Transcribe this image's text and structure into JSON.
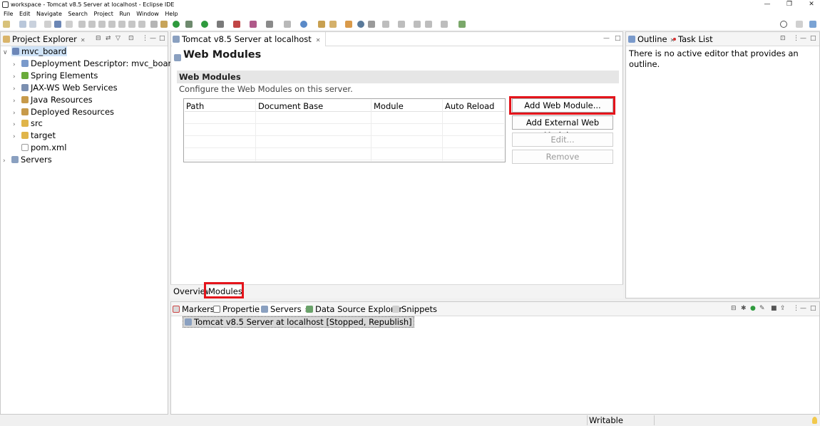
{
  "window": {
    "title": "workspace - Tomcat v8.5 Server at localhost - Eclipse IDE"
  },
  "menu": [
    "File",
    "Edit",
    "Navigate",
    "Search",
    "Project",
    "Run",
    "Window",
    "Help"
  ],
  "project_explorer": {
    "title": "Project Explorer",
    "items": [
      {
        "label": "mvc_board"
      },
      {
        "label": "Deployment Descriptor: mvc_board"
      },
      {
        "label": "Spring Elements"
      },
      {
        "label": "JAX-WS Web Services"
      },
      {
        "label": "Java Resources"
      },
      {
        "label": "Deployed Resources"
      },
      {
        "label": "src"
      },
      {
        "label": "target"
      },
      {
        "label": "pom.xml"
      },
      {
        "label": "Servers"
      }
    ]
  },
  "editor": {
    "tab_title": "Tomcat v8.5 Server at localhost",
    "page_title": "Web Modules",
    "section_title": "Web Modules",
    "section_desc": "Configure the Web Modules on this server.",
    "columns": [
      "Path",
      "Document Base",
      "Module",
      "Auto Reload"
    ],
    "buttons": {
      "add": "Add Web Module...",
      "add_external": "Add External Web Module...",
      "edit": "Edit...",
      "remove": "Remove"
    },
    "bottom_tabs": [
      "Overview",
      "Modules"
    ]
  },
  "outline": {
    "tab_outline": "Outline",
    "tab_tasks": "Task List",
    "message": "There is no active editor that provides an outline."
  },
  "bottom_panel": {
    "tabs": [
      "Markers",
      "Properties",
      "Servers",
      "Data Source Explorer",
      "Snippets"
    ],
    "server_entry": "Tomcat v8.5 Server at localhost  [Stopped, Republish]"
  },
  "status": {
    "writable": "Writable"
  },
  "colors": {
    "highlight": "#e4141b",
    "selection": "#cfe3f7"
  }
}
